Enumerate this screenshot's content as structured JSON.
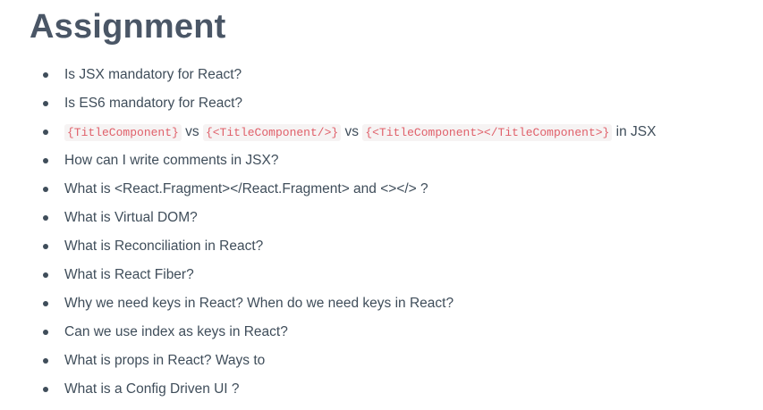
{
  "heading": "Assignment",
  "items": [
    {
      "text": "Is JSX mandatory for React?"
    },
    {
      "text": "Is ES6 mandatory for React?"
    },
    {
      "code1": "{TitleComponent}",
      "sep1": "vs",
      "code2": "{<TitleComponent/>}",
      "sep2": "vs",
      "code3": "{<TitleComponent></TitleComponent>}",
      "tail": "in JSX"
    },
    {
      "text": "How can I write comments in JSX?"
    },
    {
      "text": "What is <React.Fragment></React.Fragment> and <></> ?"
    },
    {
      "text": "What is Virtual DOM?"
    },
    {
      "text": "What is Reconciliation in React?"
    },
    {
      "text": "What is React Fiber?"
    },
    {
      "text": "Why we need keys in React? When do we need keys in React?"
    },
    {
      "text": "Can we use index as keys in React?"
    },
    {
      "text": "What is props in React? Ways to"
    },
    {
      "text": "What is a Config Driven UI ?"
    }
  ]
}
